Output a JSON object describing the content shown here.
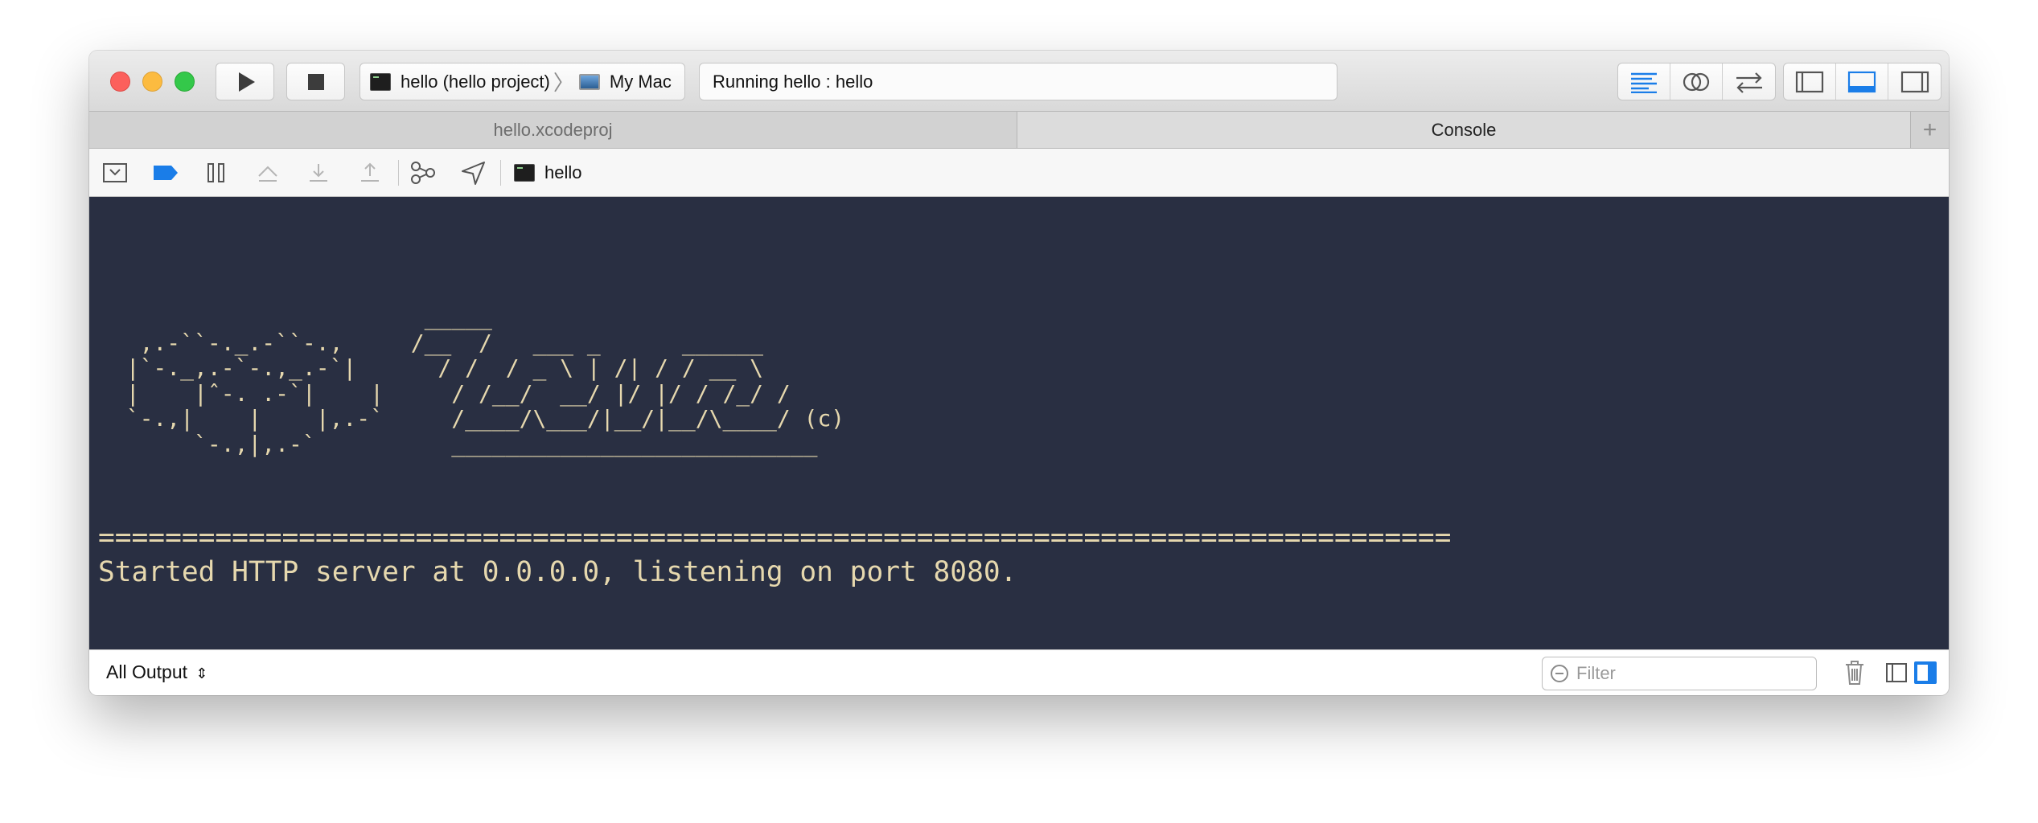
{
  "toolbar": {
    "scheme_target": "hello (hello project)",
    "scheme_device": "My Mac",
    "activity_status": "Running hello : hello"
  },
  "tabs": [
    {
      "label": "hello.xcodeproj",
      "active": false
    },
    {
      "label": "Console",
      "active": true
    }
  ],
  "debug_bar": {
    "process_label": "hello"
  },
  "console": {
    "banner_art": "                        _____\n   ,.-``-._.-``-.,     /__  /   ___ _      ______\n  |`-._,.-`-.,_.-`|      / /  / _ \\ | /| / / __ \\\n  |    |ˆ-. .-`|    |     / /__/  __/ |/ |/ / /_/ /\n  `-.,|    |    |,.-`     /____/\\___/|__/|__/\\____/ (c)\n       `-.,|,.-`          ___________________________",
    "separator": "=================================================================================",
    "message": "Started HTTP server at 0.0.0.0, listening on port 8080."
  },
  "footer": {
    "output_selector": "All Output",
    "filter_placeholder": "Filter"
  },
  "colors": {
    "console_background": "#292f42",
    "console_text": "#e6d8ae",
    "accent_blue": "#1a7de8"
  }
}
